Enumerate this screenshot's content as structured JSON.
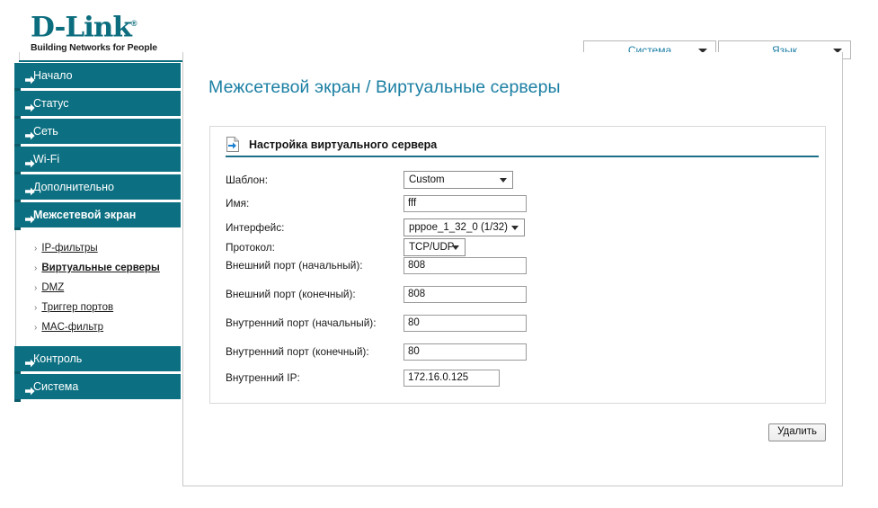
{
  "brand": {
    "name": "D-Link",
    "trademark": "®",
    "tagline": "Building Networks for People"
  },
  "header": {
    "selects": [
      {
        "label": "Система",
        "icon": "chevron-down-icon"
      },
      {
        "label": "Язык",
        "icon": "chevron-down-icon"
      }
    ]
  },
  "sidebar": {
    "items": [
      {
        "label": "Начало",
        "active": false
      },
      {
        "label": "Статус",
        "active": false
      },
      {
        "label": "Сеть",
        "active": false
      },
      {
        "label": "Wi-Fi",
        "active": false
      },
      {
        "label": "Дополнительно",
        "active": false
      },
      {
        "label": "Межсетевой экран",
        "active": true
      }
    ],
    "submenu": [
      {
        "label": "IP-фильтры",
        "current": false
      },
      {
        "label": "Виртуальные серверы",
        "current": true
      },
      {
        "label": "DMZ",
        "current": false
      },
      {
        "label": "Триггер портов",
        "current": false
      },
      {
        "label": "MAC-фильтр",
        "current": false
      }
    ],
    "items_bottom": [
      {
        "label": "Контроль",
        "active": false
      },
      {
        "label": "Система",
        "active": false
      }
    ]
  },
  "main": {
    "page_title": "Межсетевой экран / Виртуальные серверы",
    "section_title": "Настройка виртуального сервера",
    "section_icon": "page-arrow-icon",
    "fields": {
      "template": {
        "label": "Шаблон:",
        "value": "Custom"
      },
      "name": {
        "label": "Имя:",
        "value": "fff"
      },
      "interface": {
        "label": "Интерфейс:",
        "value": "pppoe_1_32_0 (1/32)"
      },
      "protocol": {
        "label": "Протокол:",
        "value": "TCP/UDP"
      },
      "ext_port_start": {
        "label": "Внешний порт (начальный):",
        "value": "808"
      },
      "ext_port_end": {
        "label": "Внешний порт (конечный):",
        "value": "808"
      },
      "int_port_start": {
        "label": "Внутренний порт (начальный):",
        "value": "80"
      },
      "int_port_end": {
        "label": "Внутренний порт (конечный):",
        "value": "80"
      },
      "internal_ip": {
        "label": "Внутренний IP:",
        "value": "172.16.0.125"
      }
    },
    "delete_button": "Удалить"
  },
  "colors": {
    "teal": "#0c7082",
    "teal_dark": "#0a5a69",
    "title_blue": "#1b7fa3",
    "rule_blue": "#1d6f8b",
    "panel_border": "#c8c8c8"
  }
}
